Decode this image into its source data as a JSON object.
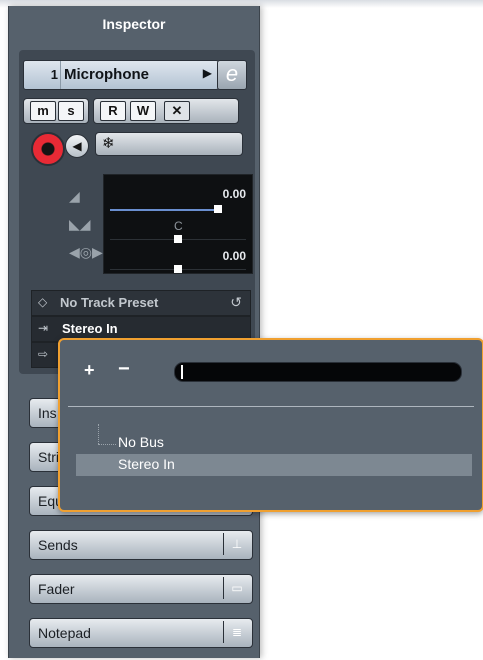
{
  "inspector": {
    "title": "Inspector",
    "track": {
      "number": "1",
      "name": "Microphone",
      "arrow": "▶",
      "edit_glyph": "e"
    },
    "buttons": {
      "mute": "m",
      "solo": "s",
      "read": "R",
      "write": "W",
      "cross": "✕"
    },
    "params": {
      "volume": "0.00",
      "pan": "C",
      "delay": "0.00"
    },
    "preset": {
      "label": "No Track Preset"
    },
    "input": {
      "label": "Stereo In"
    },
    "sections": [
      {
        "label": "Ins"
      },
      {
        "label": "Stri"
      },
      {
        "label": "Equ"
      },
      {
        "label": "Sends"
      },
      {
        "label": "Fader"
      },
      {
        "label": "Notepad"
      }
    ]
  },
  "popup": {
    "plus": "+",
    "minus": "−",
    "items": [
      {
        "label": "No Bus"
      },
      {
        "label": "Stereo In"
      }
    ]
  },
  "colors": {
    "panel": "#56616c",
    "accent_border": "#f0a030",
    "record": "#e82a35",
    "fader": "#6a8fd0"
  },
  "icons": {
    "track_edit": "edit-icon",
    "record": "record-icon",
    "monitor": "monitor-icon",
    "freeze": "freeze-icon",
    "volume": "volume-icon",
    "pan": "pan-icon",
    "delay": "delay-icon",
    "preset": "preset-icon",
    "reload": "reload-icon",
    "input": "input-routing-icon",
    "output": "output-routing-icon",
    "sends": "sends-icon",
    "fader": "fader-icon",
    "notepad": "notepad-icon"
  }
}
